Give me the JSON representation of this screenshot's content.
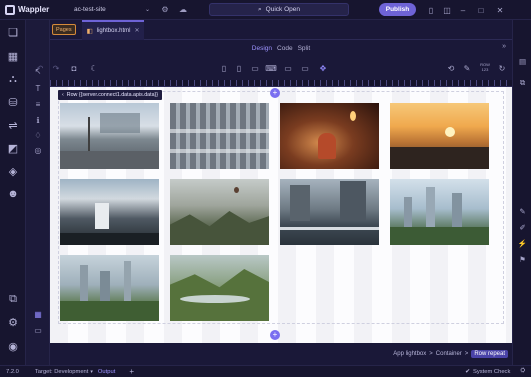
{
  "app": {
    "name": "Wappler",
    "site": "ac-test-site",
    "quick_open": "Quick Open",
    "publish": "Publish"
  },
  "tabs": {
    "pages_badge": "Pages",
    "file_name": "lightbox.html"
  },
  "view_modes": [
    "Design",
    "Code",
    "Split"
  ],
  "active_view": "Design",
  "toolbar": {
    "size_label": "ROW\n123"
  },
  "canvas": {
    "selector_label": "Row {{server.connect1.data.apis.data}}",
    "photos": [
      {
        "name": "street-scene"
      },
      {
        "name": "building-facade"
      },
      {
        "name": "lantern-interior"
      },
      {
        "name": "sunset-harbor"
      },
      {
        "name": "train-station"
      },
      {
        "name": "misty-valley"
      },
      {
        "name": "city-crossing"
      },
      {
        "name": "skyline-park"
      },
      {
        "name": "hk-skyline"
      },
      {
        "name": "river-valley"
      }
    ]
  },
  "breadcrumbs": [
    "App lightbox",
    "Container",
    "Row repeat"
  ],
  "status": {
    "version": "7.2.0",
    "target_label": "Target: Development",
    "output": "Output",
    "system_check": "System Check"
  },
  "colors": {
    "accent": "#6e63d6",
    "background": "#1a1838",
    "pages_badge": "#d58a3b"
  },
  "icons": [
    "settings-icon",
    "cloud-icon",
    "search-icon",
    "book-icon",
    "mobile-icon",
    "tablet-icon",
    "desktop-icon",
    "move-icon",
    "moon-icon",
    "undo-icon",
    "redo-icon",
    "screenshot-icon"
  ]
}
